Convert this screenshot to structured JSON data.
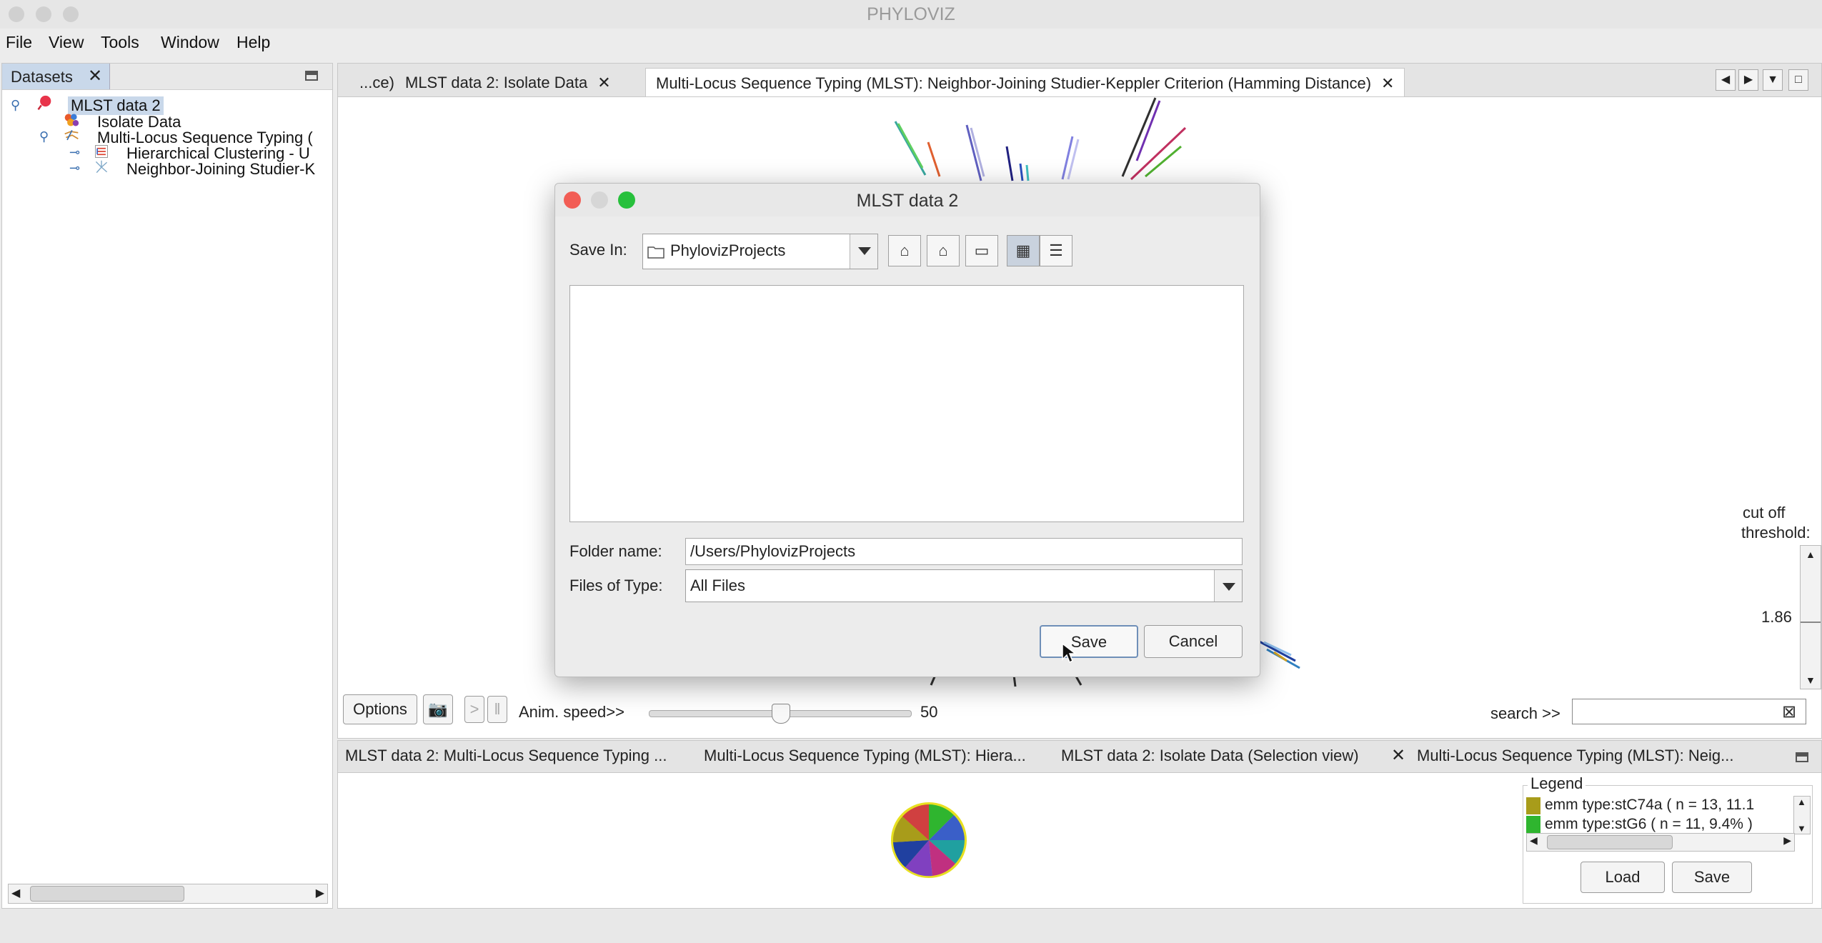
{
  "app": {
    "title": "PHYLOVIZ"
  },
  "menu": [
    "File",
    "View",
    "Tools",
    "Window",
    "Help"
  ],
  "datasets_panel": {
    "tab_label": "Datasets",
    "tree": [
      {
        "label": "MLST data 2",
        "level": 0,
        "icon": "dataset-icon"
      },
      {
        "label": "Isolate Data",
        "level": 1,
        "icon": "isolate-data-icon"
      },
      {
        "label": "Multi-Locus Sequence Typing (",
        "level": 1,
        "icon": "mlst-icon"
      },
      {
        "label": "Hierarchical Clustering  - U",
        "level": 2,
        "icon": "hierarchical-icon"
      },
      {
        "label": "Neighbor-Joining Studier-K",
        "level": 2,
        "icon": "neighbor-joining-icon"
      }
    ]
  },
  "main_tabs": [
    {
      "label": "...ce)",
      "active": false
    },
    {
      "label": "MLST data 2: Isolate Data",
      "active": false,
      "closable": true
    },
    {
      "label": "Multi-Locus Sequence Typing (MLST): Neighbor-Joining Studier-Keppler Criterion (Hamming Distance)",
      "active": true,
      "closable": true
    }
  ],
  "dialog": {
    "title": "MLST data 2",
    "save_in_label": "Save In:",
    "save_in_value": "PhylovizProjects",
    "folder_name_label": "Folder name:",
    "folder_name_value": "/Users/PhylovizProjects",
    "files_of_type_label": "Files of Type:",
    "files_of_type_value": "All Files",
    "save_button": "Save",
    "cancel_button": "Cancel"
  },
  "graph_controls": {
    "options_button": "Options",
    "anim_speed_label": "Anim. speed>>",
    "anim_speed_value": "50",
    "anim_speed_fraction": 0.5,
    "search_label": "search >>",
    "search_value": "",
    "cutoff_label_1": "cut off",
    "cutoff_label_2": "threshold:",
    "cutoff_value": "1.86"
  },
  "bottom_tabs": [
    "MLST data 2: Multi-Locus Sequence Typing ...",
    "Multi-Locus Sequence Typing (MLST): Hiera...",
    "MLST data 2: Isolate Data (Selection view)",
    "Multi-Locus Sequence Typing (MLST): Neig..."
  ],
  "legend": {
    "title": "Legend",
    "items": [
      {
        "label": "emm type:stC74a ( n = 13, 11.1",
        "color": "#a89c1a"
      },
      {
        "label": "emm type:stG6 ( n = 11, 9.4% )",
        "color": "#2fb52f"
      }
    ],
    "load_button": "Load",
    "save_button": "Save"
  },
  "colors": {
    "selection": "#c9d8ea",
    "close_light": "#f25d55",
    "zoom_light": "#27c03c"
  }
}
